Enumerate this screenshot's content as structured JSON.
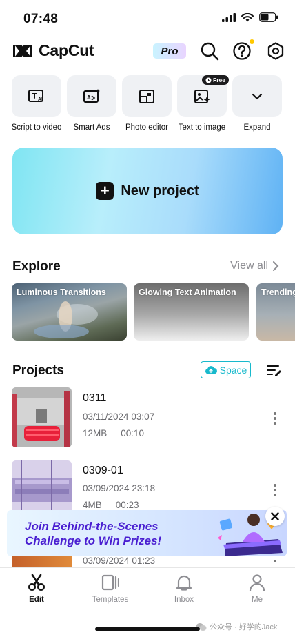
{
  "status_bar": {
    "time": "07:48"
  },
  "header": {
    "logo_text": "CapCut",
    "pro_label": "Pro"
  },
  "tools": [
    {
      "label": "Script to video",
      "icon": "script-ai-icon"
    },
    {
      "label": "Smart Ads",
      "icon": "smart-ads-icon"
    },
    {
      "label": "Photo editor",
      "icon": "photo-editor-icon"
    },
    {
      "label": "Text to image",
      "icon": "text-to-image-icon",
      "badge": "Free"
    },
    {
      "label": "Expand",
      "icon": "chevron-down-icon"
    }
  ],
  "new_project": {
    "label": "New project"
  },
  "explore": {
    "title": "Explore",
    "view_all": "View all",
    "cards": [
      {
        "title": "Luminous Transitions"
      },
      {
        "title": "Glowing Text Animation"
      },
      {
        "title": "Trending"
      }
    ]
  },
  "projects": {
    "title": "Projects",
    "space_label": "Space",
    "items": [
      {
        "name": "0311",
        "date": "03/11/2024 03:07",
        "size": "12MB",
        "duration": "00:10"
      },
      {
        "name": "0309-01",
        "date": "03/09/2024 23:18",
        "size": "4MB",
        "duration": "00:23"
      },
      {
        "name": "",
        "date": "03/09/2024 01:23",
        "size": "",
        "duration": ""
      }
    ]
  },
  "banner": {
    "line1": "Join Behind-the-Scenes",
    "line2": "Challenge to Win Prizes!"
  },
  "tabbar": {
    "tabs": [
      {
        "label": "Edit",
        "active": true
      },
      {
        "label": "Templates",
        "active": false
      },
      {
        "label": "Inbox",
        "active": false
      },
      {
        "label": "Me",
        "active": false
      }
    ]
  },
  "watermark": "公众号 · 好学的Jack",
  "colors": {
    "accent": "#18b9cc",
    "banner_text": "#4a1fd1",
    "notification_dot": "#ffc800"
  }
}
